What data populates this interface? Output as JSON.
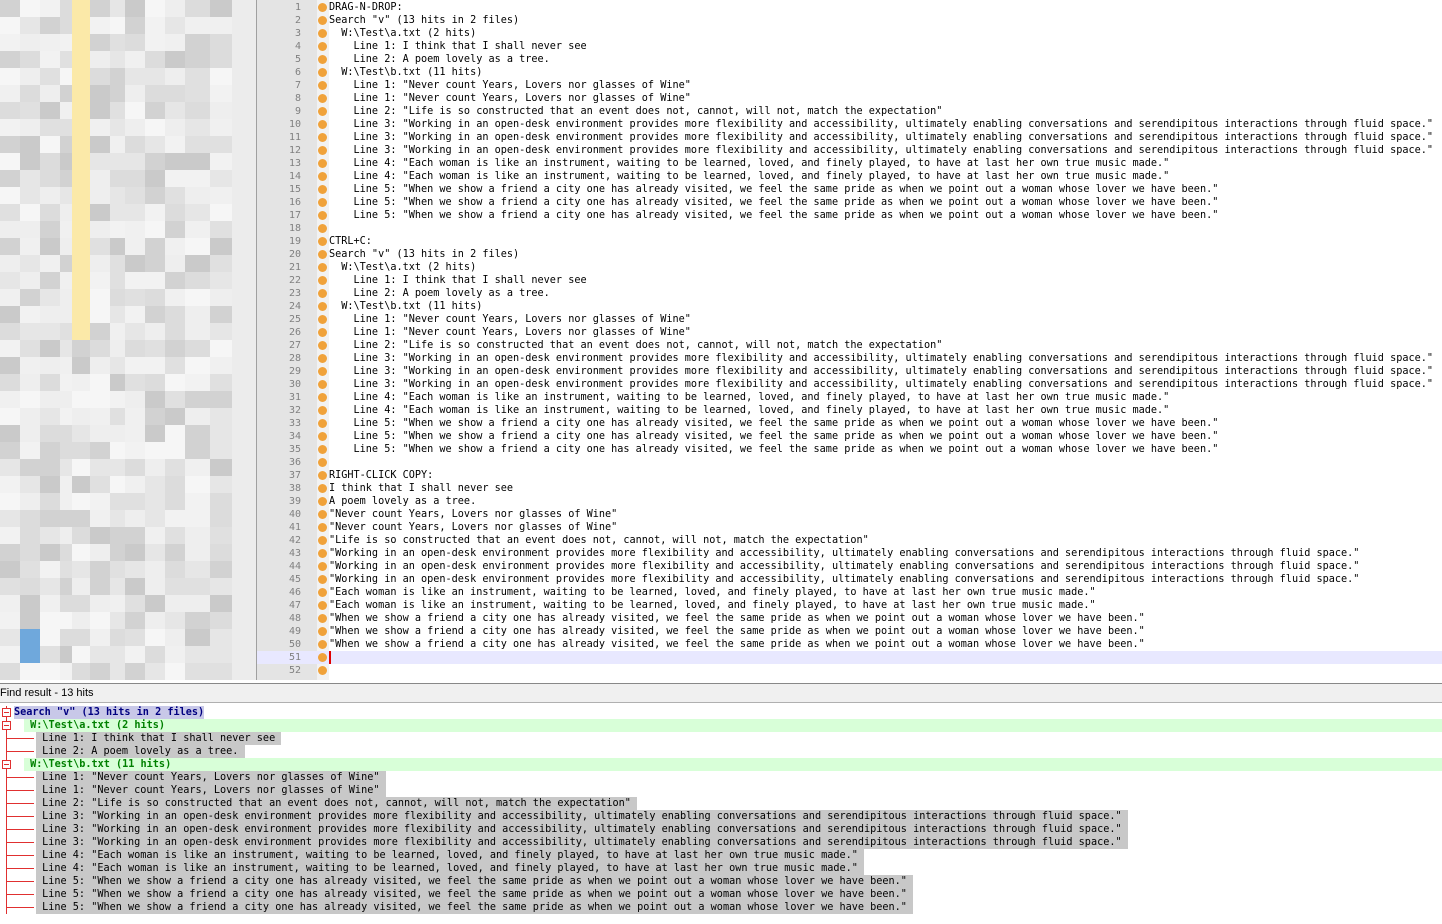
{
  "editor": {
    "lines": [
      "DRAG-N-DROP:",
      "Search \"v\" (13 hits in 2 files)",
      "  W:\\Test\\a.txt (2 hits)",
      "    Line 1: I think that I shall never see",
      "    Line 2: A poem lovely as a tree.",
      "  W:\\Test\\b.txt (11 hits)",
      "    Line 1: \"Never count Years, Lovers nor glasses of Wine\"",
      "    Line 1: \"Never count Years, Lovers nor glasses of Wine\"",
      "    Line 2: \"Life is so constructed that an event does not, cannot, will not, match the expectation\"",
      "    Line 3: \"Working in an open-desk environment provides more flexibility and accessibility, ultimately enabling conversations and serendipitous interactions through fluid space.\"",
      "    Line 3: \"Working in an open-desk environment provides more flexibility and accessibility, ultimately enabling conversations and serendipitous interactions through fluid space.\"",
      "    Line 3: \"Working in an open-desk environment provides more flexibility and accessibility, ultimately enabling conversations and serendipitous interactions through fluid space.\"",
      "    Line 4: \"Each woman is like an instrument, waiting to be learned, loved, and finely played, to have at last her own true music made.\"",
      "    Line 4: \"Each woman is like an instrument, waiting to be learned, loved, and finely played, to have at last her own true music made.\"",
      "    Line 5: \"When we show a friend a city one has already visited, we feel the same pride as when we point out a woman whose lover we have been.\"",
      "    Line 5: \"When we show a friend a city one has already visited, we feel the same pride as when we point out a woman whose lover we have been.\"",
      "    Line 5: \"When we show a friend a city one has already visited, we feel the same pride as when we point out a woman whose lover we have been.\"",
      "",
      "CTRL+C:",
      "Search \"v\" (13 hits in 2 files)",
      "  W:\\Test\\a.txt (2 hits)",
      "    Line 1: I think that I shall never see",
      "    Line 2: A poem lovely as a tree.",
      "  W:\\Test\\b.txt (11 hits)",
      "    Line 1: \"Never count Years, Lovers nor glasses of Wine\"",
      "    Line 1: \"Never count Years, Lovers nor glasses of Wine\"",
      "    Line 2: \"Life is so constructed that an event does not, cannot, will not, match the expectation\"",
      "    Line 3: \"Working in an open-desk environment provides more flexibility and accessibility, ultimately enabling conversations and serendipitous interactions through fluid space.\"",
      "    Line 3: \"Working in an open-desk environment provides more flexibility and accessibility, ultimately enabling conversations and serendipitous interactions through fluid space.\"",
      "    Line 3: \"Working in an open-desk environment provides more flexibility and accessibility, ultimately enabling conversations and serendipitous interactions through fluid space.\"",
      "    Line 4: \"Each woman is like an instrument, waiting to be learned, loved, and finely played, to have at last her own true music made.\"",
      "    Line 4: \"Each woman is like an instrument, waiting to be learned, loved, and finely played, to have at last her own true music made.\"",
      "    Line 5: \"When we show a friend a city one has already visited, we feel the same pride as when we point out a woman whose lover we have been.\"",
      "    Line 5: \"When we show a friend a city one has already visited, we feel the same pride as when we point out a woman whose lover we have been.\"",
      "    Line 5: \"When we show a friend a city one has already visited, we feel the same pride as when we point out a woman whose lover we have been.\"",
      "",
      "RIGHT-CLICK COPY:",
      "I think that I shall never see",
      "A poem lovely as a tree.",
      "\"Never count Years, Lovers nor glasses of Wine\"",
      "\"Never count Years, Lovers nor glasses of Wine\"",
      "\"Life is so constructed that an event does not, cannot, will not, match the expectation\"",
      "\"Working in an open-desk environment provides more flexibility and accessibility, ultimately enabling conversations and serendipitous interactions through fluid space.\"",
      "\"Working in an open-desk environment provides more flexibility and accessibility, ultimately enabling conversations and serendipitous interactions through fluid space.\"",
      "\"Working in an open-desk environment provides more flexibility and accessibility, ultimately enabling conversations and serendipitous interactions through fluid space.\"",
      "\"Each woman is like an instrument, waiting to be learned, loved, and finely played, to have at last her own true music made.\"",
      "\"Each woman is like an instrument, waiting to be learned, loved, and finely played, to have at last her own true music made.\"",
      "\"When we show a friend a city one has already visited, we feel the same pride as when we point out a woman whose lover we have been.\"",
      "\"When we show a friend a city one has already visited, we feel the same pride as when we point out a woman whose lover we have been.\"",
      "\"When we show a friend a city one has already visited, we feel the same pride as when we point out a woman whose lover we have been.\"",
      "",
      ""
    ],
    "current_line": 51
  },
  "find_panel": {
    "title": "Find result - 13 hits",
    "search_header": "Search \"v\" (13 hits in 2 files)",
    "groups": [
      {
        "file": "W:\\Test\\a.txt (2 hits)",
        "hits": [
          "Line 1: I think that I shall never see",
          "Line 2: A poem lovely as a tree."
        ]
      },
      {
        "file": "W:\\Test\\b.txt (11 hits)",
        "hits": [
          "Line 1: \"Never count Years, Lovers nor glasses of Wine\"",
          "Line 1: \"Never count Years, Lovers nor glasses of Wine\"",
          "Line 2: \"Life is so constructed that an event does not, cannot, will not, match the expectation\"",
          "Line 3: \"Working in an open-desk environment provides more flexibility and accessibility, ultimately enabling conversations and serendipitous interactions through fluid space.\"",
          "Line 3: \"Working in an open-desk environment provides more flexibility and accessibility, ultimately enabling conversations and serendipitous interactions through fluid space.\"",
          "Line 3: \"Working in an open-desk environment provides more flexibility and accessibility, ultimately enabling conversations and serendipitous interactions through fluid space.\"",
          "Line 4: \"Each woman is like an instrument, waiting to be learned, loved, and finely played, to have at last her own true music made.\"",
          "Line 4: \"Each woman is like an instrument, waiting to be learned, loved, and finely played, to have at last her own true music made.\"",
          "Line 5: \"When we show a friend a city one has already visited, we feel the same pride as when we point out a woman whose lover we have been.\"",
          "Line 5: \"When we show a friend a city one has already visited, we feel the same pride as when we point out a woman whose lover we have been.\"",
          "Line 5: \"When we show a friend a city one has already visited, we feel the same pride as when we point out a woman whose lover we have been.\""
        ]
      }
    ]
  },
  "colors": {
    "fold_marker": "#f0a23a",
    "tree_line": "#e03030",
    "file_highlight": "#d8ffd8",
    "search_highlight": "#c8c8e8",
    "hit_highlight": "#c8c8c8",
    "current_line": "#e8e8ff"
  }
}
